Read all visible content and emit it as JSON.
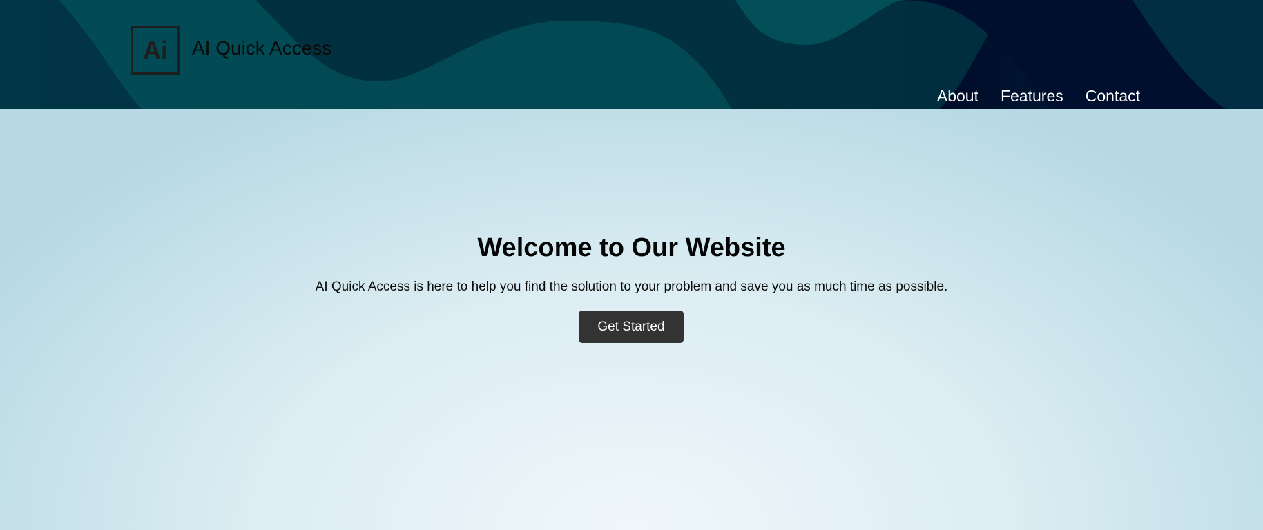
{
  "header": {
    "logo_text": "Ai",
    "site_title": "AI Quick Access",
    "nav": [
      {
        "label": "About"
      },
      {
        "label": "Features"
      },
      {
        "label": "Contact"
      }
    ]
  },
  "hero": {
    "title": "Welcome to Our Website",
    "subtitle": "AI Quick Access is here to help you find the solution to your problem and save you as much time as possible.",
    "cta_label": "Get Started"
  },
  "colors": {
    "header_dark": "#013240",
    "wave_light": "#024f58",
    "wave_navy": "#000c2a",
    "button": "#333333"
  }
}
